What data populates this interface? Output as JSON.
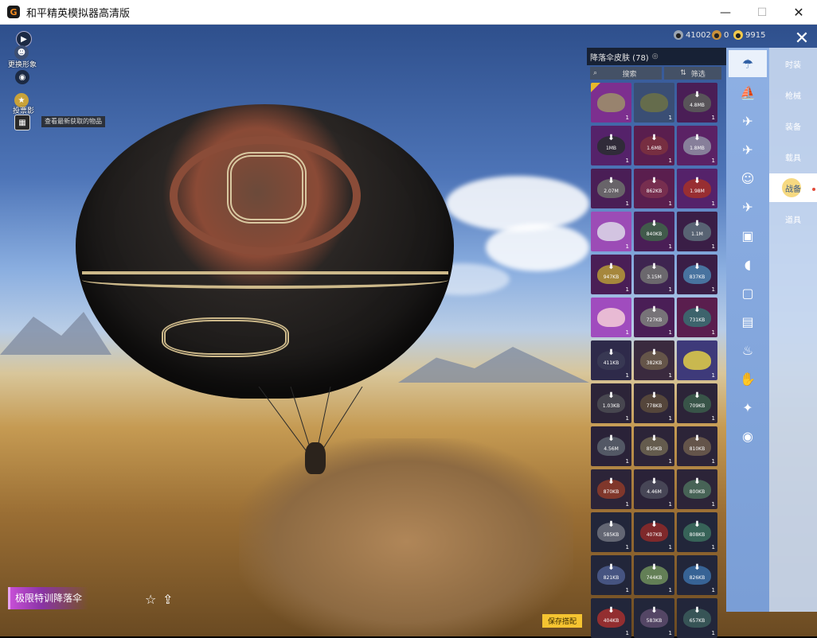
{
  "window": {
    "title": "和平精英模拟器高清版",
    "logo": "G",
    "minimize": "—",
    "maximize": "☐",
    "close": "✕"
  },
  "hud_left": {
    "items": [
      {
        "icon": "play-icon",
        "label": ""
      },
      {
        "icon": "avatar-icon",
        "label": "更换形象"
      },
      {
        "icon": "eye-icon",
        "label": ""
      },
      {
        "icon": "gold-badge-icon",
        "label": "投票影"
      },
      {
        "icon": "gift-icon",
        "label": ""
      }
    ],
    "tooltip": "查看最新获取的物品"
  },
  "currency": [
    {
      "icon": "silver-coin-icon",
      "value": "41002",
      "color": "#9aa4b2"
    },
    {
      "icon": "bronze-coin-icon",
      "value": "0",
      "color": "#c9903a"
    },
    {
      "icon": "gold-coin-icon",
      "value": "9915",
      "color": "#f2c94c"
    }
  ],
  "panel": {
    "title": "降落伞皮肤 (78)",
    "info": "◎",
    "search_label": "搜索",
    "filter_label": "筛选",
    "tiles": [
      {
        "size": "",
        "count": "1",
        "bg": "#7d2f8f",
        "thumb": "#9b8d6a",
        "dl": false,
        "equipped": true
      },
      {
        "size": "",
        "count": "1",
        "bg": "#3a4e74",
        "thumb": "#6a7048",
        "dl": false,
        "equipped": false
      },
      {
        "size": "4.8MB",
        "count": "1",
        "bg": "#4a1e56",
        "thumb": "#5a5a5a",
        "dl": true,
        "equipped": false
      },
      {
        "size": "1MB",
        "count": "1",
        "bg": "#55226a",
        "thumb": "#2c2c34",
        "dl": true,
        "equipped": false
      },
      {
        "size": "1.6MB",
        "count": "1",
        "bg": "#5a1e4e",
        "thumb": "#7a3040",
        "dl": true,
        "equipped": false
      },
      {
        "size": "1.8MB",
        "count": "1",
        "bg": "#5b2265",
        "thumb": "#8c8aa0",
        "dl": true,
        "equipped": false
      },
      {
        "size": "2.07M",
        "count": "1",
        "bg": "#4a1e56",
        "thumb": "#6c6c6c",
        "dl": true,
        "equipped": false
      },
      {
        "size": "862KB",
        "count": "1",
        "bg": "#5a1e4e",
        "thumb": "#7a3050",
        "dl": true,
        "equipped": false
      },
      {
        "size": "1.98M",
        "count": "1",
        "bg": "#55226a",
        "thumb": "#a0302c",
        "dl": true,
        "equipped": false
      },
      {
        "size": "",
        "count": "1",
        "bg": "#9c4cb6",
        "thumb": "#d9d2e6",
        "dl": false,
        "equipped": false
      },
      {
        "size": "840KB",
        "count": "1",
        "bg": "#4a1e56",
        "thumb": "#40604a",
        "dl": true,
        "equipped": false
      },
      {
        "size": "1.1M",
        "count": "1",
        "bg": "#3a1e46",
        "thumb": "#5c6a78",
        "dl": true,
        "equipped": false
      },
      {
        "size": "947KB",
        "count": "1",
        "bg": "#4a1e56",
        "thumb": "#b0923a",
        "dl": true,
        "equipped": false
      },
      {
        "size": "3.15M",
        "count": "1",
        "bg": "#3e2450",
        "thumb": "#707070",
        "dl": true,
        "equipped": false
      },
      {
        "size": "837KB",
        "count": "1",
        "bg": "#3a1e46",
        "thumb": "#4a7ca8",
        "dl": true,
        "equipped": false
      },
      {
        "size": "",
        "count": "1",
        "bg": "#a04cbe",
        "thumb": "#f0c6d6",
        "dl": false,
        "equipped": false
      },
      {
        "size": "727KB",
        "count": "1",
        "bg": "#4a1e56",
        "thumb": "#7c7c7c",
        "dl": true,
        "equipped": false
      },
      {
        "size": "731KB",
        "count": "1",
        "bg": "#5a1e4e",
        "thumb": "#3a6a70",
        "dl": true,
        "equipped": false
      },
      {
        "size": "411KB",
        "count": "1",
        "bg": "#2e2a4a",
        "thumb": "#3a3a54",
        "dl": true,
        "equipped": false
      },
      {
        "size": "382KB",
        "count": "1",
        "bg": "#3a2a3e",
        "thumb": "#6a5a4a",
        "dl": true,
        "equipped": false
      },
      {
        "size": "",
        "count": "1",
        "bg": "#3e3a7a",
        "thumb": "#d8c64a",
        "dl": false,
        "equipped": false
      },
      {
        "size": "1.03KB",
        "count": "1",
        "bg": "#2c2438",
        "thumb": "#4a4a52",
        "dl": true,
        "equipped": false
      },
      {
        "size": "778KB",
        "count": "1",
        "bg": "#2c2438",
        "thumb": "#5a4a3c",
        "dl": true,
        "equipped": false
      },
      {
        "size": "709KB",
        "count": "1",
        "bg": "#2c2438",
        "thumb": "#3a5a4a",
        "dl": true,
        "equipped": false
      },
      {
        "size": "4.56M",
        "count": "1",
        "bg": "#2a2238",
        "thumb": "#585e6a",
        "dl": true,
        "equipped": false
      },
      {
        "size": "850KB",
        "count": "1",
        "bg": "#2c2438",
        "thumb": "#6a6250",
        "dl": true,
        "equipped": false
      },
      {
        "size": "810KB",
        "count": "1",
        "bg": "#2c2438",
        "thumb": "#6a5a4c",
        "dl": true,
        "equipped": false
      },
      {
        "size": "870KB",
        "count": "1",
        "bg": "#2c2438",
        "thumb": "#8a3a2a",
        "dl": true,
        "equipped": false
      },
      {
        "size": "4.46M",
        "count": "1",
        "bg": "#2a2238",
        "thumb": "#4a4a5a",
        "dl": true,
        "equipped": false
      },
      {
        "size": "800KB",
        "count": "1",
        "bg": "#2c2438",
        "thumb": "#4a6a5a",
        "dl": true,
        "equipped": false
      },
      {
        "size": "585KB",
        "count": "1",
        "bg": "#22263a",
        "thumb": "#6a6e7a",
        "dl": true,
        "equipped": false
      },
      {
        "size": "407KB",
        "count": "1",
        "bg": "#22263a",
        "thumb": "#8a2a2a",
        "dl": true,
        "equipped": false
      },
      {
        "size": "808KB",
        "count": "1",
        "bg": "#22263a",
        "thumb": "#3a6a5c",
        "dl": true,
        "equipped": false
      },
      {
        "size": "821KB",
        "count": "1",
        "bg": "#22263a",
        "thumb": "#4a5a8a",
        "dl": true,
        "equipped": false
      },
      {
        "size": "744KB",
        "count": "1",
        "bg": "#22263a",
        "thumb": "#6a8a5a",
        "dl": true,
        "equipped": false
      },
      {
        "size": "826KB",
        "count": "1",
        "bg": "#22263a",
        "thumb": "#3a6aa0",
        "dl": true,
        "equipped": false
      },
      {
        "size": "404KB",
        "count": "1",
        "bg": "#22263a",
        "thumb": "#a03030",
        "dl": true,
        "equipped": false
      },
      {
        "size": "583KB",
        "count": "1",
        "bg": "#22263a",
        "thumb": "#5a4a6a",
        "dl": true,
        "equipped": false
      },
      {
        "size": "657KB",
        "count": "1",
        "bg": "#22263a",
        "thumb": "#3a5a5a",
        "dl": true,
        "equipped": false
      }
    ]
  },
  "categories": [
    {
      "icon": "parachute-icon",
      "glyph": "☂",
      "active": true
    },
    {
      "icon": "boat-icon",
      "glyph": "⛵",
      "active": false
    },
    {
      "icon": "plane-trail-icon",
      "glyph": "✈",
      "active": false
    },
    {
      "icon": "jet-icon",
      "glyph": "✈",
      "active": false
    },
    {
      "icon": "emote-icon",
      "glyph": "☺",
      "active": false
    },
    {
      "icon": "drone-icon",
      "glyph": "✈",
      "active": false
    },
    {
      "icon": "backpack-icon",
      "glyph": "▣",
      "active": false
    },
    {
      "icon": "speaker-icon",
      "glyph": "◖",
      "active": false
    },
    {
      "icon": "card-icon",
      "glyph": "▢",
      "active": false
    },
    {
      "icon": "picture-icon",
      "glyph": "▤",
      "active": false
    },
    {
      "icon": "spray-icon",
      "glyph": "♨",
      "active": false
    },
    {
      "icon": "hand-icon",
      "glyph": "✋",
      "active": false
    },
    {
      "icon": "sparkle-icon",
      "glyph": "✦",
      "active": false
    },
    {
      "icon": "ufo-icon",
      "glyph": "◉",
      "active": false
    }
  ],
  "tabs": [
    {
      "label": "时装",
      "active": false,
      "dot": false
    },
    {
      "label": "枪械",
      "active": false,
      "dot": false
    },
    {
      "label": "装备",
      "active": false,
      "dot": false
    },
    {
      "label": "载具",
      "active": false,
      "dot": false
    },
    {
      "label": "战备",
      "active": true,
      "dot": true
    },
    {
      "label": "道具",
      "active": false,
      "dot": false
    }
  ],
  "footer": {
    "item_name": "极限特训降落伞",
    "favorite_icon": "☆",
    "share_icon": "⇪",
    "save_label": "保存搭配"
  }
}
